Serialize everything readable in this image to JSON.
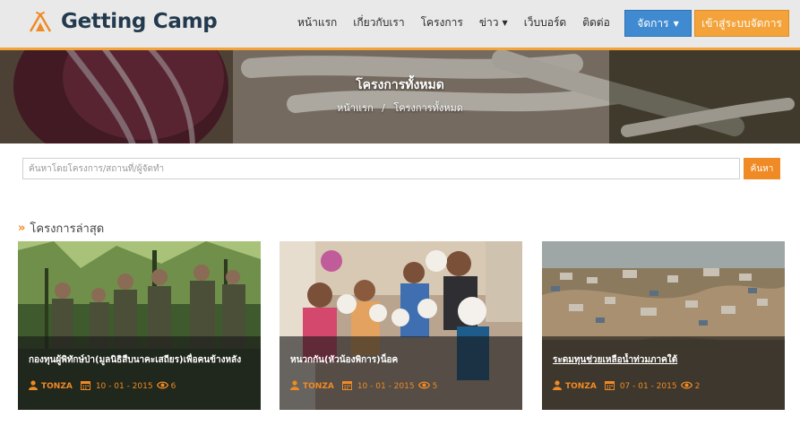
{
  "brand": {
    "name": "Getting Camp"
  },
  "nav": {
    "items": [
      {
        "label": "หน้าแรก",
        "dropdown": false
      },
      {
        "label": "เกี่ยวกับเรา",
        "dropdown": false
      },
      {
        "label": "โครงการ",
        "dropdown": false
      },
      {
        "label": "ข่าว",
        "dropdown": true
      },
      {
        "label": "เว็บบอร์ด",
        "dropdown": false
      },
      {
        "label": "ติดต่อ",
        "dropdown": false
      }
    ],
    "manage_label": "จัดการ",
    "login_label": "เข้าสู่ระบบจัดการ"
  },
  "hero": {
    "title": "โครงการทั้งหมด",
    "breadcrumb": [
      "หน้าแรก",
      "โครงการทั้งหมด"
    ],
    "separator": "/"
  },
  "search": {
    "placeholder": "ค้นหาโดยโครงการ/สถานที่/ผู้จัดทำ",
    "value": "",
    "button_label": "ค้นหา"
  },
  "section": {
    "title": "โครงการล่าสุด"
  },
  "projects": [
    {
      "title": "กองทุนผู้พิทักษ์ป่า(มูลนิธิสืบนาคะเสถียร)เพื่อคนข้างหลัง",
      "author": "TONZA",
      "date": "10 - 01 - 2015",
      "views": "6",
      "underlined": false
    },
    {
      "title": "หนวกกัน(หัวน้องพิการ)น็อค",
      "author": "TONZA",
      "date": "10 - 01 - 2015",
      "views": "5",
      "underlined": false
    },
    {
      "title": "ระดมทุนช่วยเหลือน้ำท่วมภาคใต้",
      "author": "TONZA",
      "date": "07 - 01 - 2015",
      "views": "2",
      "underlined": true
    }
  ],
  "colors": {
    "accent": "#f08a24",
    "primary": "#3f8ad0",
    "brand_text": "#233a4e",
    "header_bg": "#e9e9e9"
  }
}
